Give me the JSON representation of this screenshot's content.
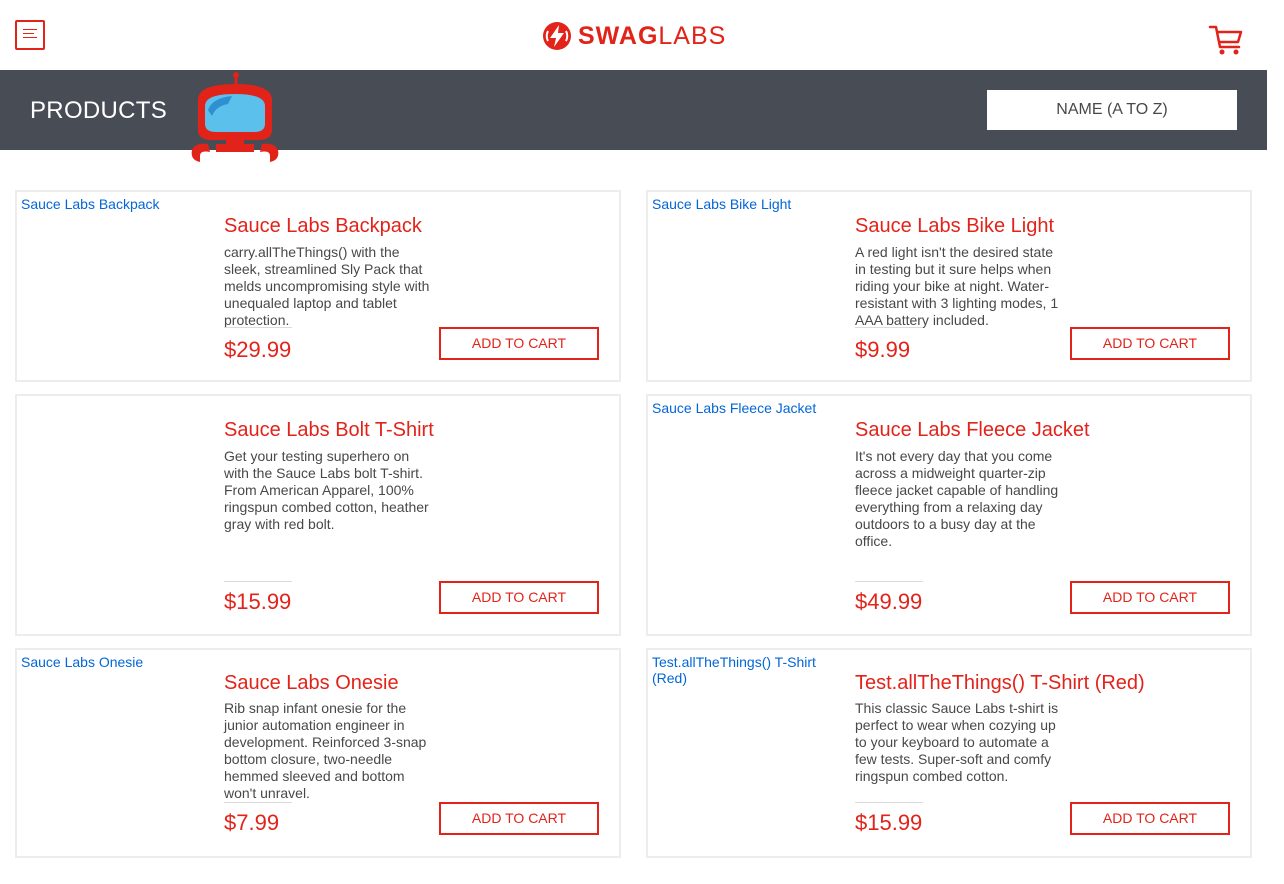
{
  "header": {
    "logo_bold": "SWAG",
    "logo_light": "LABS"
  },
  "subheader": {
    "title": "PRODUCTS",
    "sort_selected": "NAME (A TO Z)"
  },
  "colors": {
    "accent": "#e2231a",
    "subheader_bg": "#474c55",
    "link": "#0366d6"
  },
  "items": [
    {
      "image_alt": "Sauce Labs Backpack",
      "name": "Sauce Labs Backpack",
      "description": "carry.allTheThings() with the sleek, streamlined Sly Pack that melds uncompromising style with unequaled laptop and tablet protection.",
      "price": "$29.99",
      "button": "ADD TO CART"
    },
    {
      "image_alt": "Sauce Labs Bike Light",
      "name": "Sauce Labs Bike Light",
      "description": "A red light isn't the desired state in testing but it sure helps when riding your bike at night. Water-resistant with 3 lighting modes, 1 AAA battery included.",
      "price": "$9.99",
      "button": "ADD TO CART"
    },
    {
      "image_alt": "",
      "name": "Sauce Labs Bolt T-Shirt",
      "description": "Get your testing superhero on with the Sauce Labs bolt T-shirt. From American Apparel, 100% ringspun combed cotton, heather gray with red bolt.",
      "price": "$15.99",
      "button": "ADD TO CART"
    },
    {
      "image_alt": "Sauce Labs Fleece Jacket",
      "name": "Sauce Labs Fleece Jacket",
      "description": "It's not every day that you come across a midweight quarter-zip fleece jacket capable of handling everything from a relaxing day outdoors to a busy day at the office.",
      "price": "$49.99",
      "button": "ADD TO CART"
    },
    {
      "image_alt": "Sauce Labs Onesie",
      "name": "Sauce Labs Onesie",
      "description": "Rib snap infant onesie for the junior automation engineer in development. Reinforced 3-snap bottom closure, two-needle hemmed sleeved and bottom won't unravel.",
      "price": "$7.99",
      "button": "ADD TO CART"
    },
    {
      "image_alt": "Test.allTheThings() T-Shirt (Red)",
      "name": "Test.allTheThings() T-Shirt (Red)",
      "description": "This classic Sauce Labs t-shirt is perfect to wear when cozying up to your keyboard to automate a few tests. Super-soft and comfy ringspun combed cotton.",
      "price": "$15.99",
      "button": "ADD TO CART"
    }
  ]
}
